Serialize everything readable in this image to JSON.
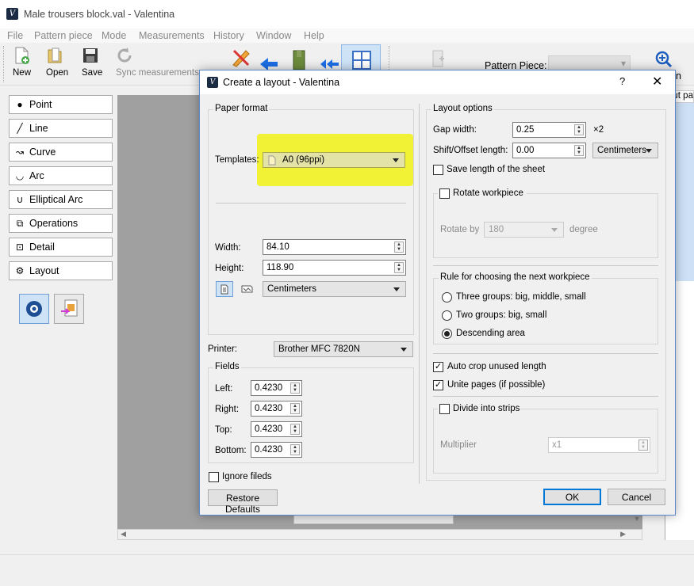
{
  "app": {
    "title": "Male trousers block.val - Valentina"
  },
  "menu": [
    "File",
    "Pattern piece",
    "Mode",
    "Measurements",
    "History",
    "Window",
    "Help"
  ],
  "toolbar": {
    "new": "New",
    "open": "Open",
    "save": "Save",
    "sync": "Sync measurements",
    "pattern_piece_label": "Pattern Piece:",
    "zoom_label": "n",
    "layout_tab": "out pat"
  },
  "tools": [
    "Point",
    "Line",
    "Curve",
    "Arc",
    "Elliptical Arc",
    "Operations",
    "Detail",
    "Layout"
  ],
  "dialog": {
    "title": "Create a layout - Valentina",
    "help": "?",
    "close": "✕",
    "paper_format": {
      "title": "Paper format",
      "templates_label": "Templates:",
      "template_value": "A0 (96ppi)",
      "width_label": "Width:",
      "width_value": "84.10",
      "height_label": "Height:",
      "height_value": "118.90",
      "units": "Centimeters"
    },
    "printer": {
      "label": "Printer:",
      "value": "Brother MFC 7820N"
    },
    "fields": {
      "title": "Fields",
      "left_label": "Left:",
      "left_value": "0.4230",
      "right_label": "Right:",
      "right_value": "0.4230",
      "top_label": "Top:",
      "top_value": "0.4230",
      "bottom_label": "Bottom:",
      "bottom_value": "0.4230"
    },
    "ignore_fields": "Ignore fileds",
    "restore_defaults": "Restore Defaults",
    "layout_options": {
      "title": "Layout options",
      "gap_label": "Gap width:",
      "gap_value": "0.25",
      "gap_suffix": "×2",
      "shift_label": "Shift/Offset length:",
      "shift_value": "0.00",
      "shift_units": "Centimeters",
      "save_length": "Save length of the sheet",
      "rotate": {
        "title": "Rotate workpiece",
        "rotate_by_label": "Rotate by",
        "rotate_by_value": "180",
        "degree": "degree"
      },
      "rule": {
        "title": "Rule for choosing the next workpiece",
        "opt1": "Three groups: big, middle, small",
        "opt2": "Two groups: big, small",
        "opt3": "Descending area"
      },
      "auto_crop": "Auto crop unused length",
      "unite_pages": "Unite pages (if possible)",
      "divide": {
        "title": "Divide into strips",
        "multiplier_label": "Multiplier",
        "multiplier_value": "x1"
      }
    },
    "ok": "OK",
    "cancel": "Cancel"
  },
  "colors": {
    "highlight": "#f0f12a",
    "accent": "#0078d7",
    "canvas": "#a0a0a0"
  }
}
